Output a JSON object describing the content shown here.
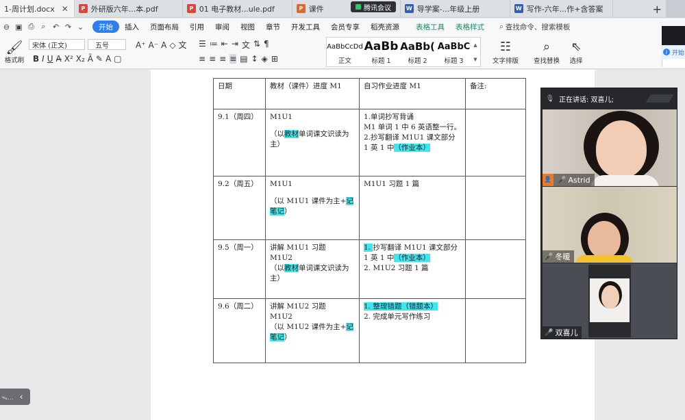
{
  "tabs": [
    {
      "label": "1-周计划.docx",
      "type": "doc",
      "active": true
    },
    {
      "label": "外研版六年...本.pdf",
      "type": "pdf"
    },
    {
      "label": "01 电子教材...ule.pdf",
      "type": "pdf"
    },
    {
      "label": "课件",
      "type": "ppt"
    },
    {
      "label": "导学案-...年级上册",
      "type": "doc"
    },
    {
      "label": "写作-六年...作+含答案",
      "type": "doc"
    }
  ],
  "meeting_pill": "腾讯会议",
  "new_tab": "+",
  "menu": {
    "items": [
      "开始",
      "插入",
      "页面布局",
      "引用",
      "审阅",
      "视图",
      "章节",
      "开发工具",
      "会员专享",
      "稻壳资源"
    ],
    "active": "开始",
    "table_tools": [
      "表格工具",
      "表格样式"
    ],
    "search_placeholder": "查找命令、搜索模板"
  },
  "ribbon": {
    "format_painter": "格式刷",
    "font_name": "宋体 (正文)",
    "font_size": "五号",
    "styles": [
      {
        "sample": "AaBbCcDd",
        "name": "正文"
      },
      {
        "sample": "AaBb",
        "name": "标题 1"
      },
      {
        "sample": "AaBb(",
        "name": "标题 2"
      },
      {
        "sample": "AaBbC",
        "name": "标题 3"
      }
    ],
    "text_layout": "文字排版",
    "find_replace": "查找替换",
    "select": "选择"
  },
  "side_info": "开始",
  "table": {
    "headers": [
      "日期",
      "教材（课件）进度 M1",
      "自习作业进度 M1",
      "备注:"
    ],
    "rows": [
      {
        "date": "9.1（周四）",
        "course": {
          "l1": "M1U1",
          "pre": "（以",
          "hl": "教材",
          "post": "单词课文识读为主）"
        },
        "hw": {
          "a": "1.单词抄写背诵",
          "b": "M1 单词 1 中 6 英语整一行。",
          "c": "2.抄写翻译 M1U1 课文部分 1 英 1 中",
          "c_hl": "（作业本）"
        }
      },
      {
        "date": "9.2（周五）",
        "course": {
          "l1": "M1U1",
          "pre": "（以 M1U1 课件为主+",
          "hl": "记笔记",
          "post": "）"
        },
        "hw": {
          "a": "M1U1  习题 1 篇"
        }
      },
      {
        "date": "9.5（周一）",
        "course": {
          "l1": "讲解 M1U1  习题",
          "l2": "M1U2",
          "pre": "（以",
          "hl": "教材",
          "post": "单词课文识读为主）"
        },
        "hw": {
          "a_hl": "1. ",
          "a": "抄写翻译 M1U1 课文部分 1 英 1 中",
          "a_hl2": "（作业本）",
          "b": "2.  M1U2  习题 1 篇"
        }
      },
      {
        "date": "9.6（周二）",
        "course": {
          "l1": "讲解 M1U2  习题",
          "l2": "M1U2",
          "pre": "（以 M1U2 课件为主+",
          "hl": "记笔记",
          "post": "）"
        },
        "hw": {
          "a_hl": "1.  整理错题（错题本）",
          "b": "2.  完成单元写作练习"
        }
      }
    ]
  },
  "meeting": {
    "speaking_label": "正在讲话: 双喜儿;",
    "participants": [
      {
        "name": "Astrid",
        "host": true
      },
      {
        "name": "冬暖",
        "host": false
      },
      {
        "name": "双喜儿",
        "host": false
      }
    ]
  }
}
